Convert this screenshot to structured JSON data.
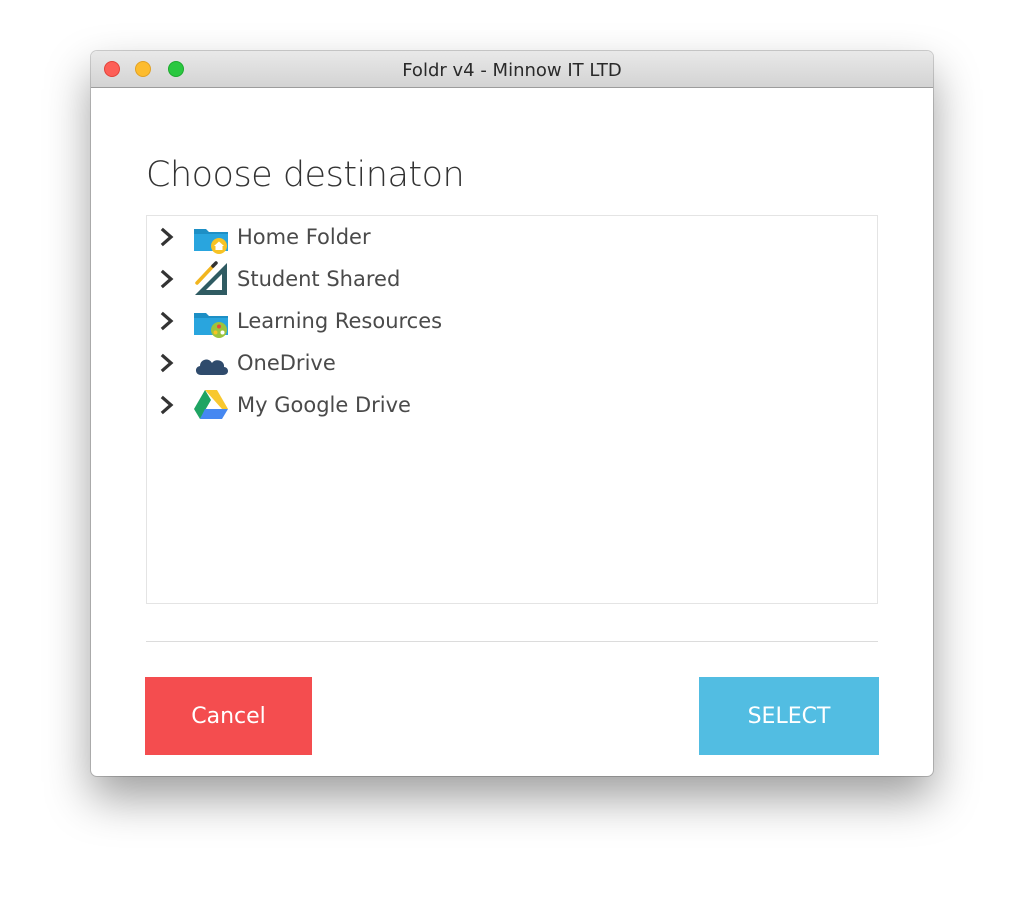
{
  "window": {
    "title": "Foldr v4 - Minnow IT LTD"
  },
  "dialog": {
    "heading": "Choose destinaton",
    "tree": [
      {
        "label": "Home Folder",
        "icon": "home-folder-icon"
      },
      {
        "label": "Student Shared",
        "icon": "set-square-pencil-icon"
      },
      {
        "label": "Learning Resources",
        "icon": "shared-folder-icon"
      },
      {
        "label": "OneDrive",
        "icon": "cloud-icon"
      },
      {
        "label": "My Google Drive",
        "icon": "google-drive-icon"
      }
    ],
    "cancel_label": "Cancel",
    "select_label": "SELECT"
  },
  "colors": {
    "cancel": "#f44d4f",
    "select": "#52bde2"
  }
}
